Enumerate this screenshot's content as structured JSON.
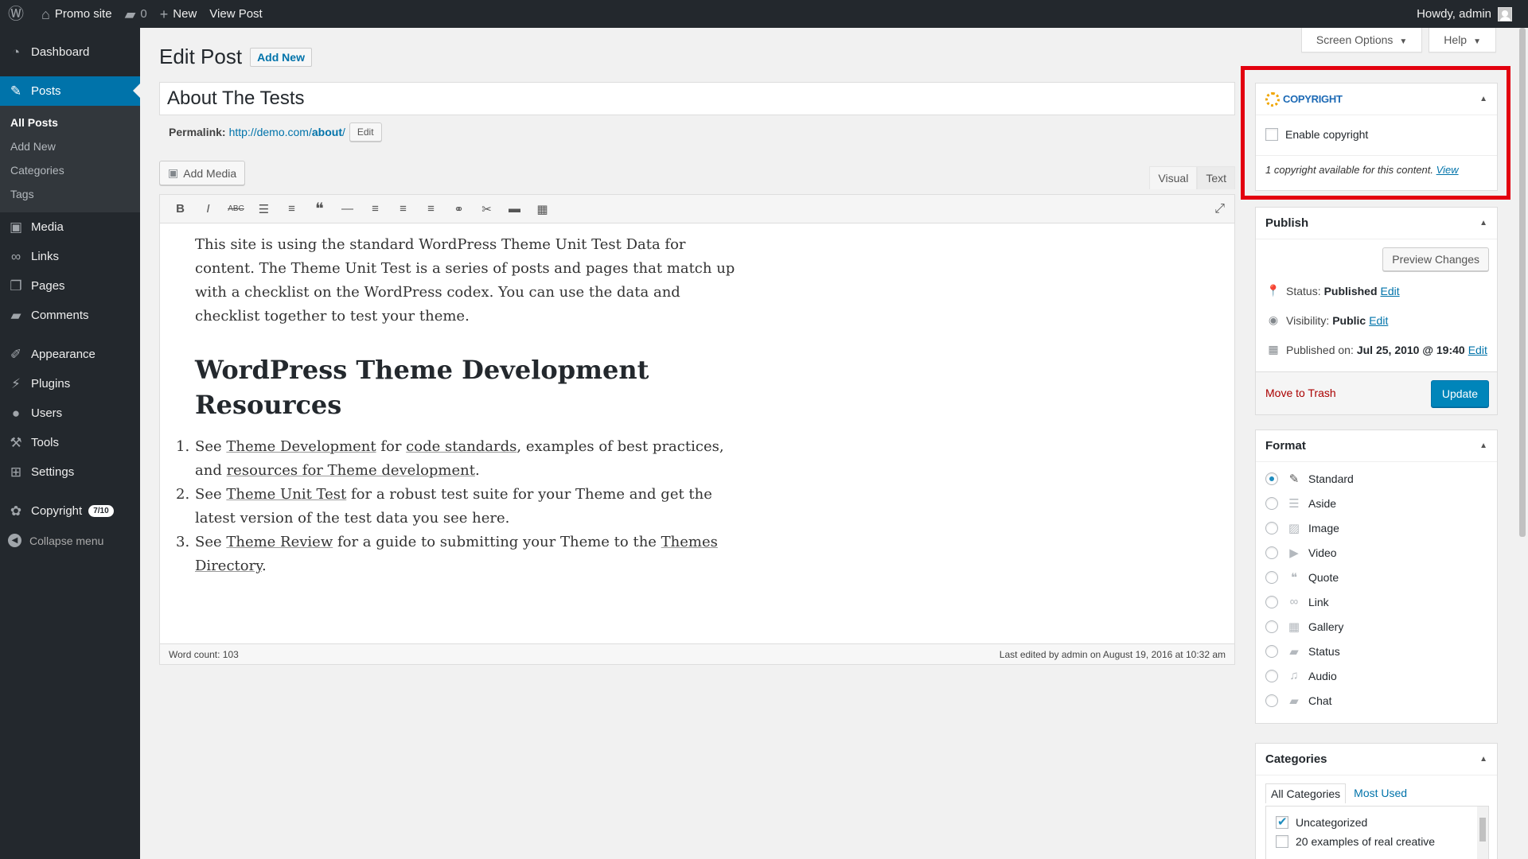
{
  "adminbar": {
    "site_name": "Promo site",
    "comments_count": "0",
    "new_label": "New",
    "view_post_label": "View Post",
    "howdy": "Howdy, admin"
  },
  "sidebar": {
    "dashboard": "Dashboard",
    "posts": "Posts",
    "posts_sub": [
      "All Posts",
      "Add New",
      "Categories",
      "Tags"
    ],
    "media": "Media",
    "links": "Links",
    "pages": "Pages",
    "comments": "Comments",
    "appearance": "Appearance",
    "plugins": "Plugins",
    "users": "Users",
    "tools": "Tools",
    "settings": "Settings",
    "copyright": "Copyright",
    "copyright_badge": "7/10",
    "collapse": "Collapse menu"
  },
  "screen_tabs": {
    "screen_options": "Screen Options",
    "help": "Help"
  },
  "header": {
    "title": "Edit Post",
    "add_new": "Add New"
  },
  "post": {
    "title": "About The Tests",
    "permalink_label": "Permalink:",
    "permalink_base": "http://demo.com/",
    "permalink_slug": "about",
    "permalink_tail": "/",
    "permalink_edit": "Edit"
  },
  "editor": {
    "add_media": "Add Media",
    "tab_visual": "Visual",
    "tab_text": "Text",
    "paragraph": "This site is using the standard WordPress Theme Unit Test Data for content. The Theme Unit Test is a series of posts and pages that match up with a checklist on the WordPress codex. You can use the data and checklist together to test your theme.",
    "heading": "WordPress Theme Development Resources",
    "list": [
      {
        "num": "1.",
        "pre": "See ",
        "link1": "Theme Development",
        "mid": " for ",
        "link2": "code standards",
        "mid2": ", examples of best practices, and ",
        "link3": "resources for Theme development",
        "post": "."
      },
      {
        "num": "2.",
        "pre": "See ",
        "link1": "Theme Unit Test",
        "mid": " for a robust test suite for your Theme and get the latest version of the test data you see here."
      },
      {
        "num": "3.",
        "pre": "See ",
        "link1": "Theme Review",
        "mid": " for a guide to submitting your Theme to the ",
        "link2": "Themes Directory",
        "post": "."
      }
    ],
    "word_count": "Word count: 103",
    "last_edited": "Last edited by admin on August 19, 2016 at 10:32 am"
  },
  "copyright_box": {
    "logo_text": "COPYRIGHT",
    "enable_label": "Enable copyright",
    "info": "1 copyright available for this content.",
    "view_link": "View",
    "frame_color": "#e3000f"
  },
  "publish_box": {
    "title": "Publish",
    "preview": "Preview Changes",
    "status_label": "Status:",
    "status_value": "Published",
    "visibility_label": "Visibility:",
    "visibility_value": "Public",
    "published_label": "Published on:",
    "published_value": "Jul 25, 2010 @ 19:40",
    "edit": "Edit",
    "trash": "Move to Trash",
    "update": "Update"
  },
  "format_box": {
    "title": "Format",
    "options": [
      "Standard",
      "Aside",
      "Image",
      "Video",
      "Quote",
      "Link",
      "Gallery",
      "Status",
      "Audio",
      "Chat"
    ],
    "selected": "Standard"
  },
  "categories_box": {
    "title": "Categories",
    "tab_all": "All Categories",
    "tab_used": "Most Used",
    "items": [
      "Uncategorized",
      "20 examples of real creative"
    ]
  }
}
